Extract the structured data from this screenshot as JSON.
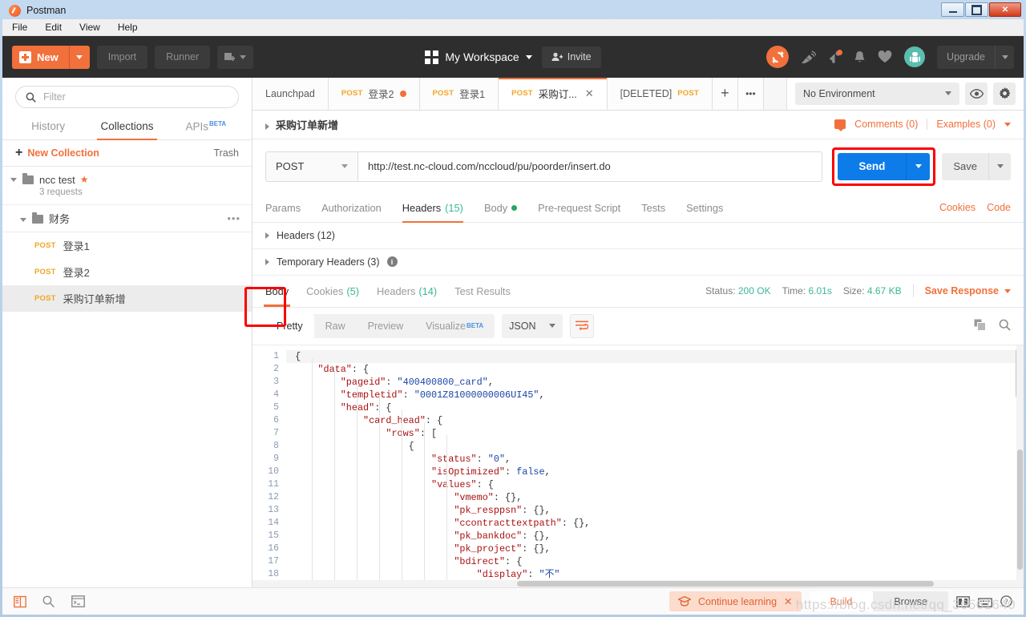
{
  "window": {
    "title": "Postman",
    "controls": {
      "minimize": "minimize-icon",
      "maximize": "maximize-icon",
      "close": "✕"
    }
  },
  "menu": {
    "items": [
      "File",
      "Edit",
      "View",
      "Help"
    ]
  },
  "toolbar": {
    "new_label": "New",
    "import_label": "Import",
    "runner_label": "Runner",
    "workspace_label": "My Workspace",
    "invite_label": "Invite",
    "upgrade_label": "Upgrade",
    "icons": [
      "sync-icon",
      "satellite-icon",
      "megaphone-icon",
      "bell-icon",
      "heart-icon",
      "avatar-icon"
    ]
  },
  "sidebar": {
    "filter_placeholder": "Filter",
    "filter_value": "",
    "tabs": [
      {
        "label": "History",
        "active": false,
        "beta": false
      },
      {
        "label": "Collections",
        "active": true,
        "beta": false
      },
      {
        "label": "APIs",
        "active": false,
        "beta": true,
        "beta_label": "BETA"
      }
    ],
    "new_collection_label": "New Collection",
    "trash_label": "Trash",
    "collection": {
      "name": "ncc test",
      "request_count": "3 requests",
      "starred": true
    },
    "folder": {
      "name": "财务"
    },
    "requests": [
      {
        "method": "POST",
        "name": "登录1",
        "selected": false
      },
      {
        "method": "POST",
        "name": "登录2",
        "selected": false
      },
      {
        "method": "POST",
        "name": "采购订单新增",
        "selected": true
      }
    ]
  },
  "tabbar": {
    "tabs": [
      {
        "label": "Launchpad",
        "method": "",
        "active": false,
        "unsaved": false,
        "closable": false,
        "deleted": false
      },
      {
        "label": "登录2",
        "method": "POST",
        "active": false,
        "unsaved": true,
        "closable": false,
        "deleted": false
      },
      {
        "label": "登录1",
        "method": "POST",
        "active": false,
        "unsaved": false,
        "closable": false,
        "deleted": false
      },
      {
        "label": "采购订...",
        "method": "POST",
        "active": true,
        "unsaved": false,
        "closable": true,
        "deleted": false
      },
      {
        "label": "[DELETED]",
        "method": "POST",
        "active": false,
        "unsaved": false,
        "closable": false,
        "deleted": true
      }
    ],
    "add_label": "+",
    "more_label": "•••"
  },
  "environment": {
    "selected": "No Environment",
    "eye_icon": "eye-icon",
    "settings_icon": "gear-icon"
  },
  "breadcrumb": {
    "title": "采购订单新增",
    "comments": "Comments (0)",
    "examples": "Examples (0)"
  },
  "request": {
    "method": "POST",
    "url": "http://test.nc-cloud.com/nccloud/pu/poorder/insert.do",
    "send_label": "Send",
    "save_label": "Save",
    "tabs": [
      {
        "label": "Params",
        "active": false,
        "count": "",
        "dot": false
      },
      {
        "label": "Authorization",
        "active": false,
        "count": "",
        "dot": false
      },
      {
        "label": "Headers",
        "active": true,
        "count": "(15)",
        "dot": false
      },
      {
        "label": "Body",
        "active": false,
        "count": "",
        "dot": true
      },
      {
        "label": "Pre-request Script",
        "active": false,
        "count": "",
        "dot": false
      },
      {
        "label": "Tests",
        "active": false,
        "count": "",
        "dot": false
      },
      {
        "label": "Settings",
        "active": false,
        "count": "",
        "dot": false
      }
    ],
    "cookies_link": "Cookies",
    "code_link": "Code",
    "sections": [
      {
        "label": "Headers (12)",
        "info": false
      },
      {
        "label": "Temporary Headers (3)",
        "info": true
      }
    ]
  },
  "response": {
    "tabs": [
      {
        "label": "Body",
        "active": true,
        "count": ""
      },
      {
        "label": "Cookies",
        "active": false,
        "count": "(5)"
      },
      {
        "label": "Headers",
        "active": false,
        "count": "(14)"
      },
      {
        "label": "Test Results",
        "active": false,
        "count": ""
      }
    ],
    "status_label": "Status:",
    "status_value": "200 OK",
    "time_label": "Time:",
    "time_value": "6.01s",
    "size_label": "Size:",
    "size_value": "4.67 KB",
    "save_response_label": "Save Response",
    "formats": [
      {
        "label": "Pretty",
        "active": true,
        "beta": false
      },
      {
        "label": "Raw",
        "active": false,
        "beta": false
      },
      {
        "label": "Preview",
        "active": false,
        "beta": false
      },
      {
        "label": "Visualize",
        "active": false,
        "beta": true,
        "beta_label": "BETA"
      }
    ],
    "language": "JSON",
    "wrap_icon": "word-wrap-icon",
    "copy_icon": "copy-icon",
    "search_icon": "search-icon"
  },
  "code": {
    "lines": [
      {
        "n": 1,
        "indent": 0,
        "html": "{"
      },
      {
        "n": 2,
        "indent": 1,
        "html": "<span class=\"k\">\"data\"</span>: {"
      },
      {
        "n": 3,
        "indent": 2,
        "html": "<span class=\"k\">\"pageid\"</span>: <span class=\"s\">\"400400800_card\"</span>,"
      },
      {
        "n": 4,
        "indent": 2,
        "html": "<span class=\"k\">\"templetid\"</span>: <span class=\"s\">\"0001Z81000000006UI45\"</span>,"
      },
      {
        "n": 5,
        "indent": 2,
        "html": "<span class=\"k\">\"head\"</span>: {"
      },
      {
        "n": 6,
        "indent": 3,
        "html": "<span class=\"k\">\"card_head\"</span>: {"
      },
      {
        "n": 7,
        "indent": 4,
        "html": "<span class=\"k\">\"rows\"</span>: ["
      },
      {
        "n": 8,
        "indent": 5,
        "html": "{"
      },
      {
        "n": 9,
        "indent": 6,
        "html": "<span class=\"k\">\"status\"</span>: <span class=\"s\">\"0\"</span>,"
      },
      {
        "n": 10,
        "indent": 6,
        "html": "<span class=\"k\">\"isOptimized\"</span>: <span class=\"b\">false</span>,"
      },
      {
        "n": 11,
        "indent": 6,
        "html": "<span class=\"k\">\"values\"</span>: {"
      },
      {
        "n": 12,
        "indent": 7,
        "html": "<span class=\"k\">\"vmemo\"</span>: {},"
      },
      {
        "n": 13,
        "indent": 7,
        "html": "<span class=\"k\">\"pk_resppsn\"</span>: {},"
      },
      {
        "n": 14,
        "indent": 7,
        "html": "<span class=\"k\">\"ccontracttextpath\"</span>: {},"
      },
      {
        "n": 15,
        "indent": 7,
        "html": "<span class=\"k\">\"pk_bankdoc\"</span>: {},"
      },
      {
        "n": 16,
        "indent": 7,
        "html": "<span class=\"k\">\"pk_project\"</span>: {},"
      },
      {
        "n": 17,
        "indent": 7,
        "html": "<span class=\"k\">\"bdirect\"</span>: {"
      },
      {
        "n": 18,
        "indent": 8,
        "html": "<span class=\"k\">\"display\"</span>: <span class=\"s\">\"不\"</span>"
      }
    ]
  },
  "statusbar": {
    "icons": [
      "sidebar-toggle-icon",
      "find-icon",
      "console-icon"
    ],
    "continue_learning": "Continue learning",
    "build_label": "Build",
    "browse_label": "Browse",
    "watermark": "https://blog.csdn.net/qq_36561640"
  }
}
